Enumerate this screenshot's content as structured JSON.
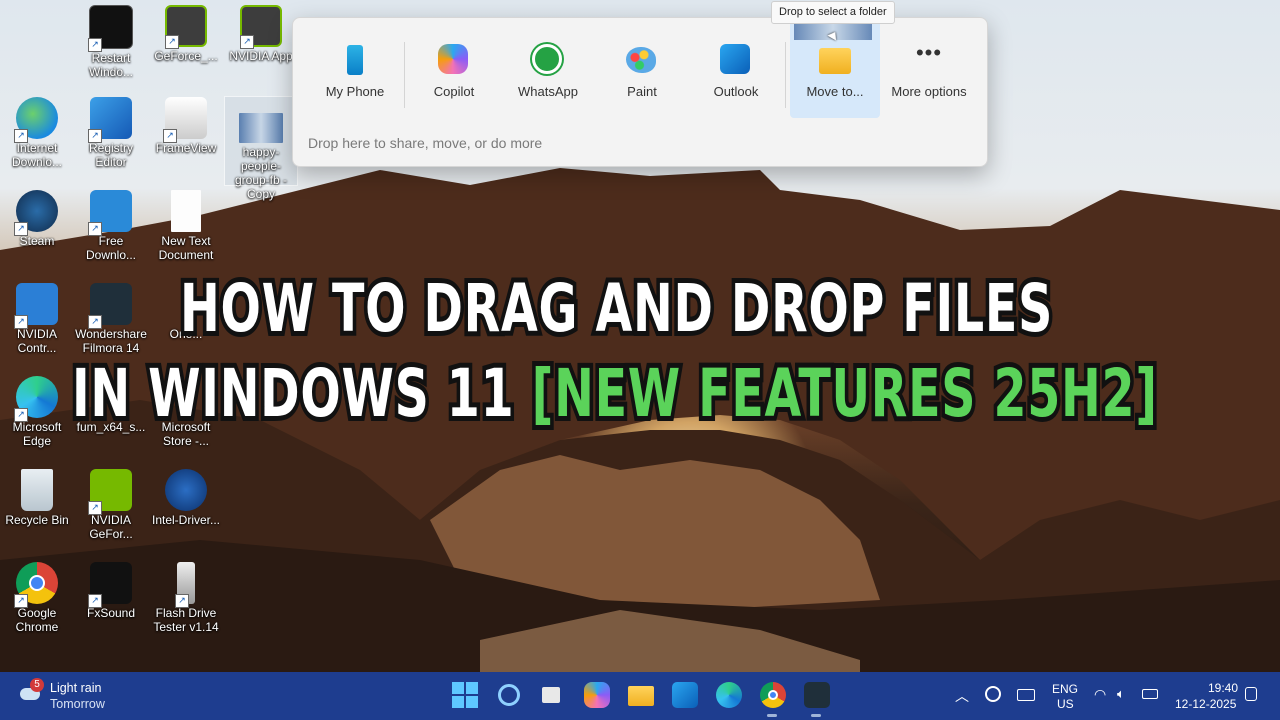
{
  "desktop_icons": [
    {
      "label": "Restart Windo...",
      "icon": "restart-icon"
    },
    {
      "label": "GeForce_...",
      "icon": "geforce-icon"
    },
    {
      "label": "NVIDIA App",
      "icon": "nvidia-app-icon"
    },
    {
      "label": "Internet Downlo...",
      "icon": "idm-icon"
    },
    {
      "label": "Registry Editor",
      "icon": "registry-editor-icon"
    },
    {
      "label": "FrameView",
      "icon": "frameview-icon"
    },
    {
      "label": "happy-people-group-fb - Copy",
      "icon": "image-file-icon"
    },
    {
      "label": "Steam",
      "icon": "steam-icon"
    },
    {
      "label": "Free Downlo...",
      "icon": "free-download-manager-icon"
    },
    {
      "label": "New Text Document",
      "icon": "text-document-icon"
    },
    {
      "label": "NVIDIA Contr...",
      "icon": "nvidia-control-icon"
    },
    {
      "label": "Wondershare Filmora 14",
      "icon": "filmora-icon"
    },
    {
      "label": "One...",
      "icon": "onedrive-icon"
    },
    {
      "label": "Microsoft Edge",
      "icon": "edge-icon"
    },
    {
      "label": "fum_x64_s...",
      "icon": "installer-icon"
    },
    {
      "label": "Microsoft Store -...",
      "icon": "store-icon"
    },
    {
      "label": "Recycle Bin",
      "icon": "recycle-bin-icon"
    },
    {
      "label": "NVIDIA GeFor...",
      "icon": "nvidia-geforce-icon"
    },
    {
      "label": "Intel-Driver...",
      "icon": "intel-driver-icon"
    },
    {
      "label": "Google Chrome",
      "icon": "chrome-icon"
    },
    {
      "label": "FxSound",
      "icon": "fxsound-icon"
    },
    {
      "label": "Flash Drive Tester v1.14",
      "icon": "usb-drive-icon"
    }
  ],
  "share": {
    "tooltip": "Drop to select a folder",
    "targets": [
      {
        "label": "My Phone",
        "icon": "phone-icon"
      },
      {
        "label": "Copilot",
        "icon": "copilot-icon"
      },
      {
        "label": "WhatsApp",
        "icon": "whatsapp-icon"
      },
      {
        "label": "Paint",
        "icon": "paint-icon"
      },
      {
        "label": "Outlook",
        "icon": "outlook-icon"
      },
      {
        "label": "Move to...",
        "icon": "folder-icon"
      },
      {
        "label": "More options",
        "icon": "more-icon"
      }
    ],
    "hint": "Drop here to share, move, or do more"
  },
  "title": {
    "line1": "HOW TO DRAG AND DROP FILES",
    "line2_white": "IN WINDOWS 11",
    "line2_green": "[NEW FEATURES 25H2]",
    "accent": "#5bd35a"
  },
  "taskbar": {
    "weather_badge": "5",
    "weather_line1": "Light rain",
    "weather_line2": "Tomorrow",
    "apps": [
      "start-icon",
      "search-icon",
      "task-view-icon",
      "copilot-icon",
      "file-explorer-icon",
      "outlook-icon",
      "edge-icon",
      "chrome-icon",
      "filmora-icon"
    ],
    "lang1": "ENG",
    "lang2": "US",
    "time": "19:40",
    "date": "12-12-2025",
    "color": "#1e3d8f"
  }
}
